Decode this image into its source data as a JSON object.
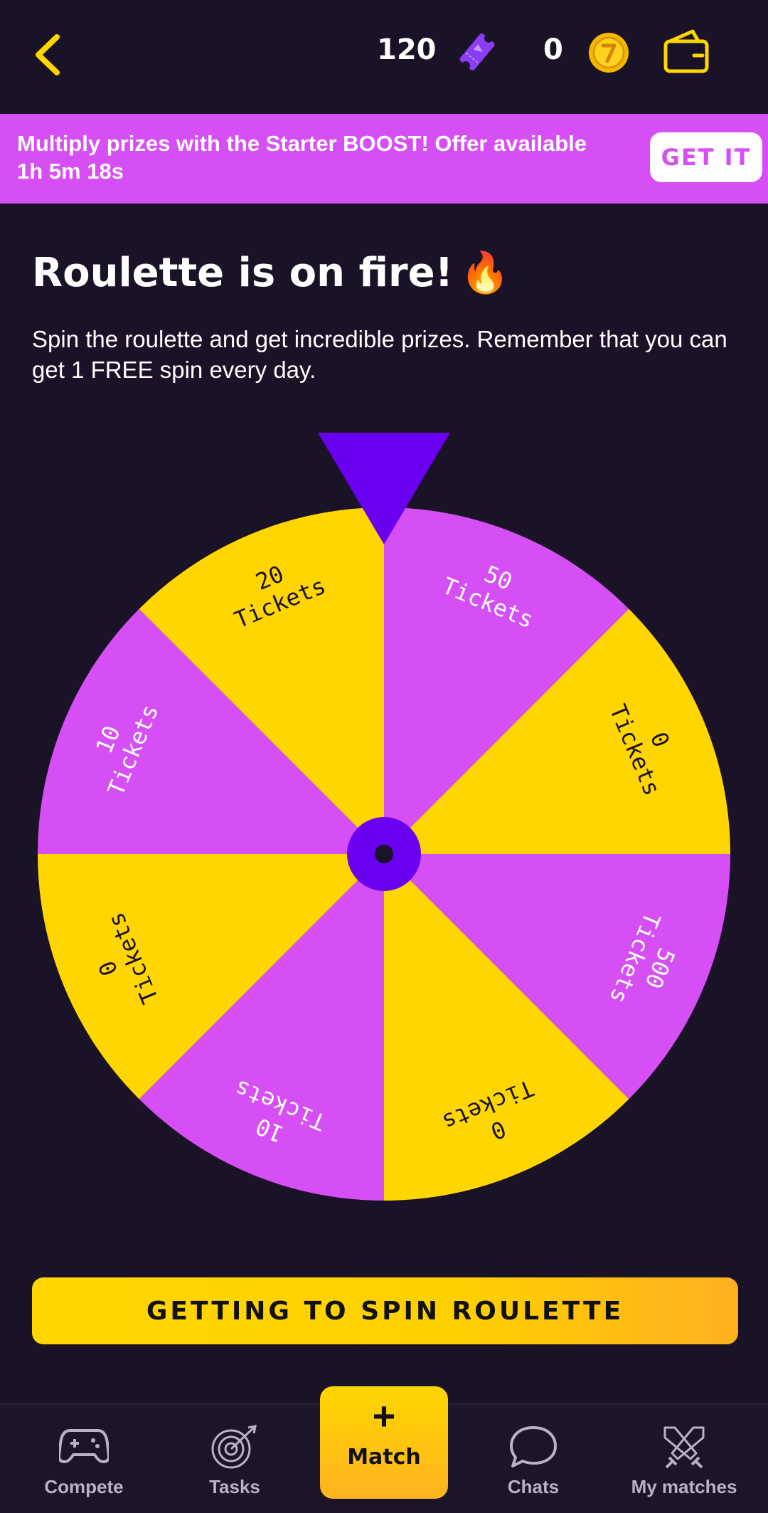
{
  "header": {
    "ticket_count": "120",
    "coin_count": "0"
  },
  "banner": {
    "text": "Multiply prizes with the Starter BOOST! Offer available 1h 5m 18s",
    "button_label": "GET IT"
  },
  "page": {
    "title": "Roulette is on fire!",
    "title_emoji": "🔥",
    "subtitle": "Spin the roulette and get incredible prizes. Remember that you can get 1 FREE spin every day."
  },
  "wheel": {
    "segments": [
      {
        "amount": "50",
        "unit": "Tickets",
        "color": "#d64ff5"
      },
      {
        "amount": "0",
        "unit": "Tickets",
        "color": "#ffd600"
      },
      {
        "amount": "500",
        "unit": "Tickets",
        "color": "#d64ff5"
      },
      {
        "amount": "0",
        "unit": "Tickets",
        "color": "#ffd600"
      },
      {
        "amount": "10",
        "unit": "Tickets",
        "color": "#d64ff5"
      },
      {
        "amount": "0",
        "unit": "Tickets",
        "color": "#ffd600"
      },
      {
        "amount": "10",
        "unit": "Tickets",
        "color": "#d64ff5"
      },
      {
        "amount": "20",
        "unit": "Tickets",
        "color": "#ffd600"
      }
    ],
    "pointer_color": "#6a00f0",
    "hub_color": "#6a00f0"
  },
  "spin_button": {
    "label": "GETTING TO SPIN ROULETTE"
  },
  "bottom_nav": {
    "compete": "Compete",
    "tasks": "Tasks",
    "match_plus": "+",
    "match": "Match",
    "chats": "Chats",
    "my_matches": "My matches"
  },
  "colors": {
    "background": "#1a1226",
    "accent_yellow": "#ffd600",
    "accent_pink": "#d64ff5",
    "accent_purple": "#6a00f0"
  },
  "icons": [
    "back-arrow-icon",
    "ticket-icon",
    "coin-icon",
    "wallet-icon",
    "gamepad-icon",
    "target-icon",
    "chat-bubble-icon",
    "crossed-swords-icon"
  ]
}
